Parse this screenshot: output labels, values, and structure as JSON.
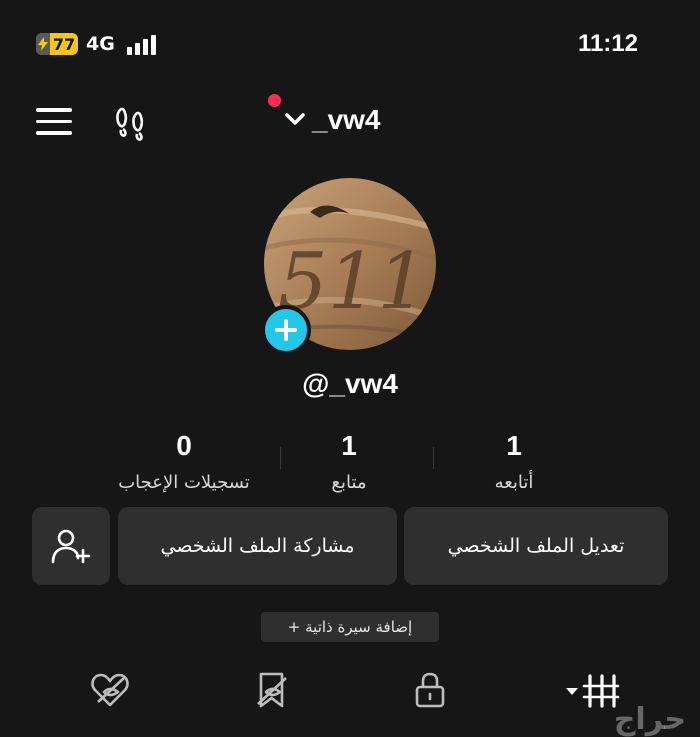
{
  "status_bar": {
    "battery_level": "77",
    "network": "4G",
    "time": "11:12"
  },
  "header": {
    "username": "_vw4",
    "icons": [
      "menu-icon",
      "footprint-icon",
      "chevron-down-icon"
    ]
  },
  "profile": {
    "handle": "@_vw4",
    "avatar_text": "511"
  },
  "stats": [
    {
      "value": "1",
      "label": "أتابعه"
    },
    {
      "value": "1",
      "label": "متابع"
    },
    {
      "value": "0",
      "label": "تسجيلات الإعجاب"
    }
  ],
  "actions": {
    "edit_profile": "تعديل الملف الشخصي",
    "share_profile": "مشاركة الملف الشخصي",
    "add_bio": "+ إضافة سيرة ذاتية"
  },
  "tabs": [
    "videos-grid-icon",
    "lock-icon",
    "bookmark-icon",
    "liked-icon"
  ],
  "watermark": "حراج",
  "colors": {
    "background": "#161616",
    "button": "#2f2f2f",
    "accent_blue": "#25c7e8",
    "notification_red": "#fe2c55",
    "battery_yellow": "#f5c518"
  }
}
